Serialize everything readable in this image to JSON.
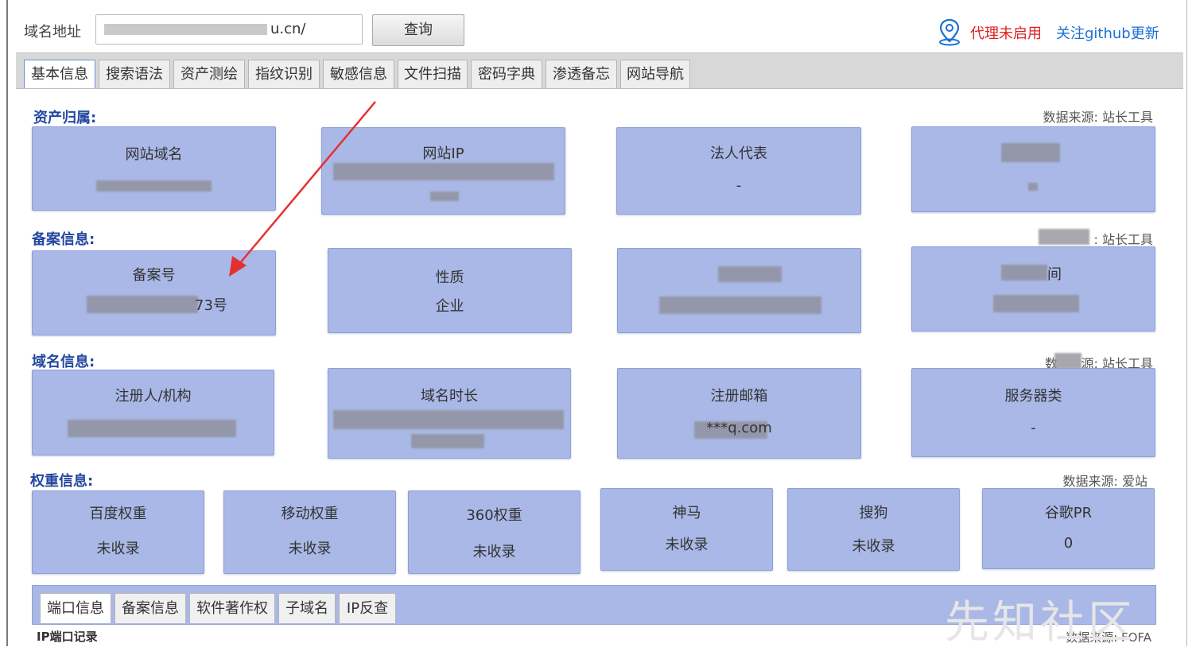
{
  "topbar": {
    "domain_label": "域名地址",
    "domain_value_visible": "u.cn/",
    "query_button": "查询",
    "proxy_status": "代理未启用",
    "github_link": "关注github更新"
  },
  "tabs": [
    {
      "label": "基本信息",
      "active": true
    },
    {
      "label": "搜索语法"
    },
    {
      "label": "资产测绘"
    },
    {
      "label": "指纹识别"
    },
    {
      "label": "敏感信息"
    },
    {
      "label": "文件扫描"
    },
    {
      "label": "密码字典"
    },
    {
      "label": "渗透备忘"
    },
    {
      "label": "网站导航"
    }
  ],
  "asset_section": {
    "title": "资产归属:",
    "source": "数据来源: 站长工具",
    "cards": [
      {
        "title": "网站域名",
        "value": ""
      },
      {
        "title": "网站IP",
        "value": ""
      },
      {
        "title": "法人代表",
        "value": "-"
      },
      {
        "title": "",
        "value": ""
      }
    ]
  },
  "icp_section": {
    "title": "备案信息:",
    "source": ": 站长工具",
    "cards": [
      {
        "title": "备案号",
        "value": "73号"
      },
      {
        "title": "性质",
        "value": "企业"
      },
      {
        "title": "",
        "value": ""
      },
      {
        "title": "间",
        "value": ""
      }
    ]
  },
  "domain_section": {
    "title": "域名信息:",
    "source_prefix": "数",
    "source": "源: 站长工具",
    "cards": [
      {
        "title": "注册人/机构",
        "value": ""
      },
      {
        "title": "域名时长",
        "value": ""
      },
      {
        "title": "注册邮箱",
        "value": "***q.com"
      },
      {
        "title": "服务器类",
        "value": "-"
      }
    ]
  },
  "weight_section": {
    "title": "权重信息:",
    "source": "数据来源: 爱站",
    "cards": [
      {
        "title": "百度权重",
        "value": "未收录"
      },
      {
        "title": "移动权重",
        "value": "未收录"
      },
      {
        "title": "360权重",
        "value": "未收录"
      },
      {
        "title": "神马",
        "value": "未收录"
      },
      {
        "title": "搜狗",
        "value": "未收录"
      },
      {
        "title": "谷歌PR",
        "value": "0"
      }
    ]
  },
  "bottom": {
    "tabs": [
      "端口信息",
      "备案信息",
      "软件著作权",
      "子域名",
      "IP反查"
    ],
    "records_label": "IP端口记录",
    "source": "数据来源: FOFA"
  },
  "watermark": "先知社区",
  "colors": {
    "card_bg": "#a9b8e6",
    "section_title": "#2347a0",
    "proxy_red": "#e02020",
    "link_blue": "#1a6fd6",
    "arrow_red": "#e53030"
  }
}
